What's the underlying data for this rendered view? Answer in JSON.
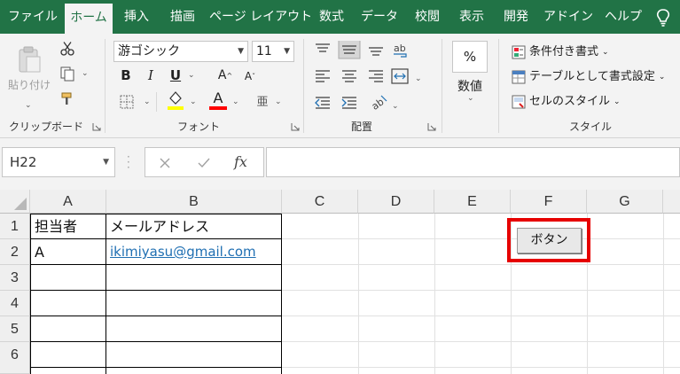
{
  "ribbon_tabs": [
    "ファイル",
    "ホーム",
    "挿入",
    "描画",
    "ページ レイアウト",
    "数式",
    "データ",
    "校閲",
    "表示",
    "開発",
    "アドイン",
    "ヘルプ"
  ],
  "active_tab": "ホーム",
  "clipboard": {
    "paste_label": "貼り付け",
    "group_label": "クリップボード"
  },
  "font": {
    "name": "游ゴシック",
    "size": "11",
    "bold": "B",
    "italic": "I",
    "underline": "U",
    "grow": "A",
    "shrink": "A",
    "font_color_letter": "A",
    "phonetic": "亜",
    "group_label": "フォント",
    "highlight_color": "#ffff00",
    "font_color": "#ff0000"
  },
  "alignment": {
    "group_label": "配置"
  },
  "number": {
    "percent": "%",
    "label": "数値"
  },
  "styles": {
    "conditional": "条件付き書式",
    "format_table": "テーブルとして書式設定",
    "cell_styles": "セルのスタイル",
    "group_label": "スタイル"
  },
  "formula_bar": {
    "name_box": "H22",
    "fx": "fx"
  },
  "grid": {
    "columns": [
      "A",
      "B",
      "C",
      "D",
      "E",
      "F",
      "G"
    ],
    "rows": [
      "1",
      "2",
      "3",
      "4",
      "5",
      "6"
    ],
    "cells": {
      "A1": "担当者",
      "B1": "メールアドレス",
      "A2": "A",
      "B2": "ikimiyasu@gmail.com"
    }
  },
  "form_button": {
    "label": "ボタン"
  },
  "colors": {
    "accent": "#217346",
    "highlight_border": "#e60000",
    "link": "#1f6fb2"
  }
}
